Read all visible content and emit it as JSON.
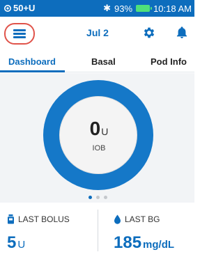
{
  "status_bar": {
    "pod_status": "50+U",
    "battery_percent": "93%",
    "time": "10:18 AM",
    "icons": [
      "pod-icon",
      "bluetooth-icon",
      "battery-icon"
    ]
  },
  "header": {
    "date": "Jul 2",
    "icons": [
      "menu-icon",
      "gear-icon",
      "bell-icon"
    ]
  },
  "tabs": [
    {
      "label": "Dashboard",
      "active": true
    },
    {
      "label": "Basal",
      "active": false
    },
    {
      "label": "Pod Info",
      "active": false
    }
  ],
  "dashboard": {
    "iob_value": "0",
    "iob_unit": "U",
    "iob_label": "IOB",
    "page_indicator": {
      "count": 3,
      "active_index": 0
    }
  },
  "summary": {
    "last_bolus_label": "LAST BOLUS",
    "last_bolus_value": "5",
    "last_bolus_unit": "U",
    "last_bg_label": "LAST BG",
    "last_bg_value": "185",
    "last_bg_unit": "mg/dL"
  },
  "colors": {
    "accent": "#0d6dbd",
    "ring": "#1578c8",
    "highlight": "#e0534a",
    "battery": "#4ee07a"
  }
}
